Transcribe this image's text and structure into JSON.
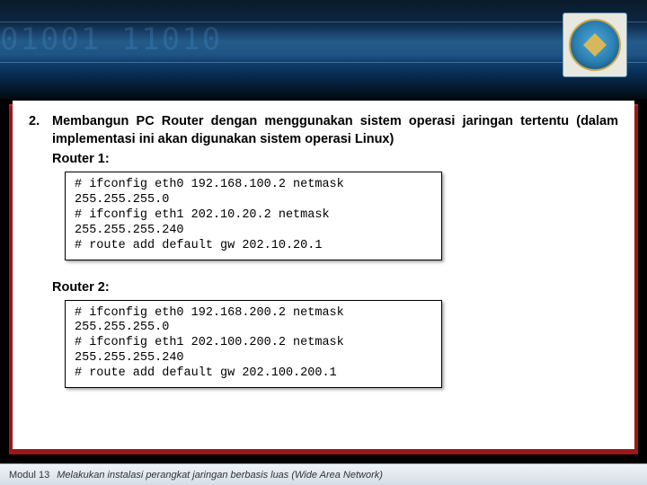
{
  "header": {
    "binary_deco": "01001\n11010"
  },
  "content": {
    "item_number": "2.",
    "item_text": "Membangun PC Router dengan menggunakan sistem operasi jaringan tertentu (dalam implementasi ini akan digunakan sistem operasi Linux)",
    "router1_label": "Router 1:",
    "router1_code": "# ifconfig eth0 192.168.100.2 netmask 255.255.255.0\n# ifconfig eth1 202.10.20.2 netmask 255.255.255.240\n# route add default gw 202.10.20.1",
    "router2_label": "Router 2:",
    "router2_code": "# ifconfig eth0 192.168.200.2 netmask 255.255.255.0\n# ifconfig eth1 202.100.200.2 netmask 255.255.255.240\n# route add default gw 202.100.200.1"
  },
  "footer": {
    "module": "Modul 13",
    "title": "Melakukan instalasi perangkat jaringan berbasis luas (Wide Area Network)"
  }
}
